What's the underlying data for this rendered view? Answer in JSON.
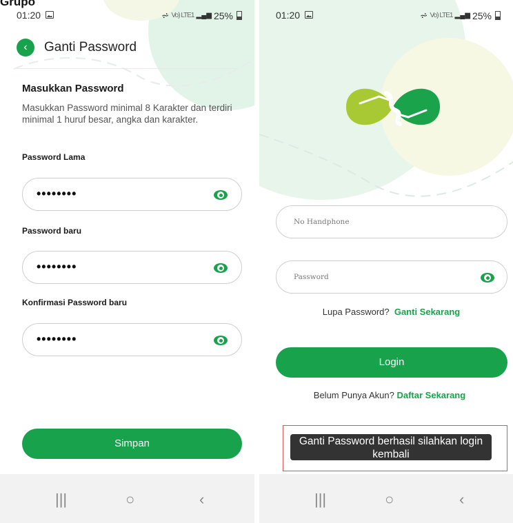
{
  "caption": "Grupo",
  "colors": {
    "accent": "#18a24c",
    "toast_bg": "#333333",
    "highlight": "#e05454"
  },
  "status_bar": {
    "time": "01:20",
    "battery": "25%",
    "network": "Vo) LTE1",
    "image_icon": "image-icon"
  },
  "left": {
    "title": "Ganti Password",
    "section_title": "Masukkan Password",
    "section_desc": "Masukkan Password minimal 8 Karakter dan terdiri minimal 1 huruf besar, angka dan karakter.",
    "fields": [
      {
        "label": "Password Lama",
        "value": "••••••••"
      },
      {
        "label": "Password baru",
        "value": "••••••••"
      },
      {
        "label": "Konfirmasi Password baru",
        "value": "••••••••"
      }
    ],
    "save_button": "Simpan"
  },
  "right": {
    "phone_placeholder": "No Handphone",
    "password_placeholder": "Password",
    "forgot_prompt": "Lupa Password?",
    "forgot_link": "Ganti Sekarang",
    "login_button": "Login",
    "register_prompt": "Belum Punya Akun?",
    "register_link": "Daftar Sekarang",
    "toast": "Ganti Password berhasil silahkan login kembali"
  },
  "nav": {
    "recents": "|||",
    "home": "○",
    "back": "‹"
  }
}
